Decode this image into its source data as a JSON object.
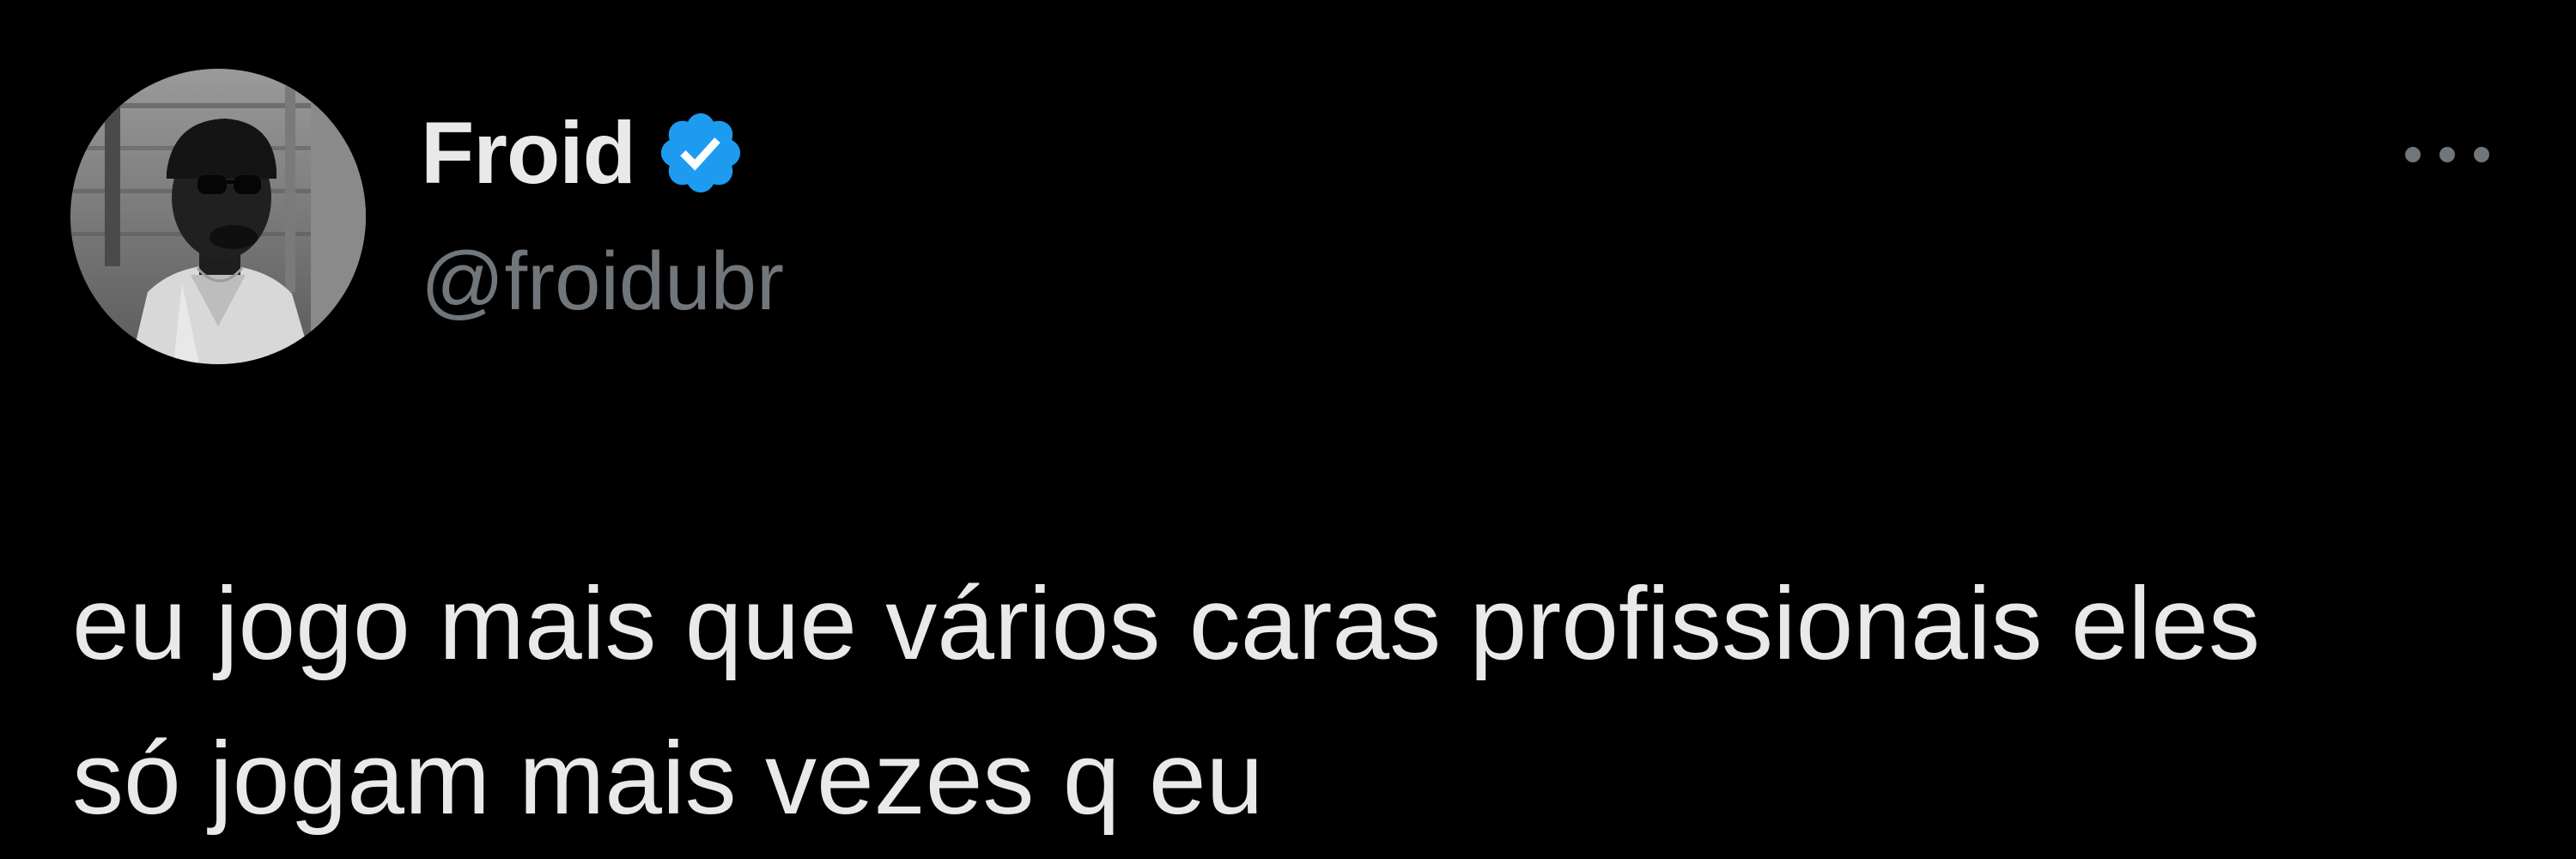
{
  "tweet": {
    "author": {
      "display_name": "Froid",
      "handle": "@froidubr",
      "verified": true,
      "avatar": "profile-photo"
    },
    "text": "eu jogo mais que vários caras profissionais eles\nsó jogam mais vezes q eu",
    "more_icon": "ellipsis-horizontal-icon",
    "verified_icon": "verified-badge-icon"
  },
  "colors": {
    "background": "#000000",
    "primary_text": "#e7e9ea",
    "secondary_text": "#71767b",
    "verified_blue": "#1d9bf0"
  }
}
